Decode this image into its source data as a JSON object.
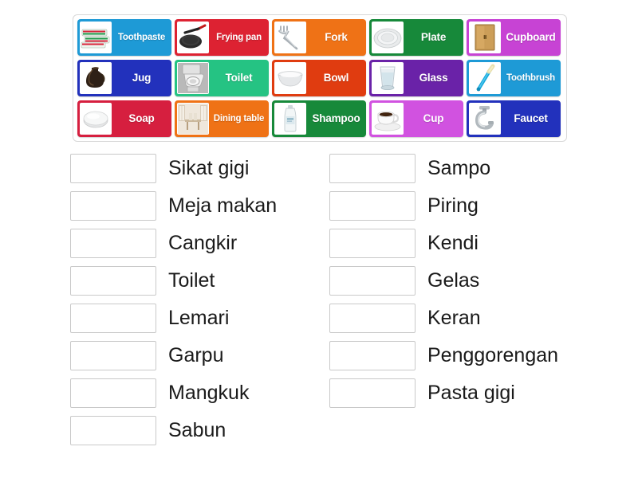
{
  "activity": {
    "type": "match-up",
    "language_pair": "English - Indonesian"
  },
  "tile_bank": {
    "rows": [
      [
        {
          "label": "Toothpaste",
          "color": "#1e9ad6",
          "icon": "toothpaste-icon"
        },
        {
          "label": "Frying pan",
          "color": "#dd2232",
          "icon": "frying-pan-icon"
        },
        {
          "label": "Fork",
          "color": "#ef7216",
          "icon": "fork-icon"
        },
        {
          "label": "Plate",
          "color": "#17893a",
          "icon": "plate-icon"
        },
        {
          "label": "Cupboard",
          "color": "#c743d4",
          "icon": "cupboard-icon"
        }
      ],
      [
        {
          "label": "Jug",
          "color": "#2231bc",
          "icon": "jug-icon"
        },
        {
          "label": "Toilet",
          "color": "#25c383",
          "icon": "toilet-icon"
        },
        {
          "label": "Bowl",
          "color": "#e03c10",
          "icon": "bowl-icon"
        },
        {
          "label": "Glass",
          "color": "#6a22a8",
          "icon": "glass-icon"
        },
        {
          "label": "Toothbrush",
          "color": "#1e9ad6",
          "icon": "toothbrush-icon"
        }
      ],
      [
        {
          "label": "Soap",
          "color": "#d61f3f",
          "icon": "soap-icon"
        },
        {
          "label": "Dining table",
          "color": "#ef7216",
          "icon": "dining-table-icon"
        },
        {
          "label": "Shampoo",
          "color": "#17893a",
          "icon": "shampoo-bottle-icon"
        },
        {
          "label": "Cup",
          "color": "#d152e0",
          "icon": "coffee-cup-icon"
        },
        {
          "label": "Faucet",
          "color": "#2231bc",
          "icon": "faucet-icon"
        }
      ]
    ]
  },
  "answers": {
    "left_column": [
      {
        "box_value": "",
        "label": "Sikat gigi"
      },
      {
        "box_value": "",
        "label": "Meja makan"
      },
      {
        "box_value": "",
        "label": "Cangkir"
      },
      {
        "box_value": "",
        "label": "Toilet"
      },
      {
        "box_value": "",
        "label": "Lemari"
      },
      {
        "box_value": "",
        "label": "Garpu"
      },
      {
        "box_value": "",
        "label": "Mangkuk"
      },
      {
        "box_value": "",
        "label": "Sabun"
      }
    ],
    "right_column": [
      {
        "box_value": "",
        "label": "Sampo"
      },
      {
        "box_value": "",
        "label": "Piring"
      },
      {
        "box_value": "",
        "label": "Kendi"
      },
      {
        "box_value": "",
        "label": "Gelas"
      },
      {
        "box_value": "",
        "label": "Keran"
      },
      {
        "box_value": "",
        "label": "Penggorengan"
      },
      {
        "box_value": "",
        "label": "Pasta gigi"
      }
    ]
  },
  "colors": {
    "container_border": "#d8d8d8",
    "drop_box_border": "#c9c9c9",
    "text": "#1a1a1a",
    "tile_text": "#ffffff",
    "page_background": "#ffffff"
  }
}
